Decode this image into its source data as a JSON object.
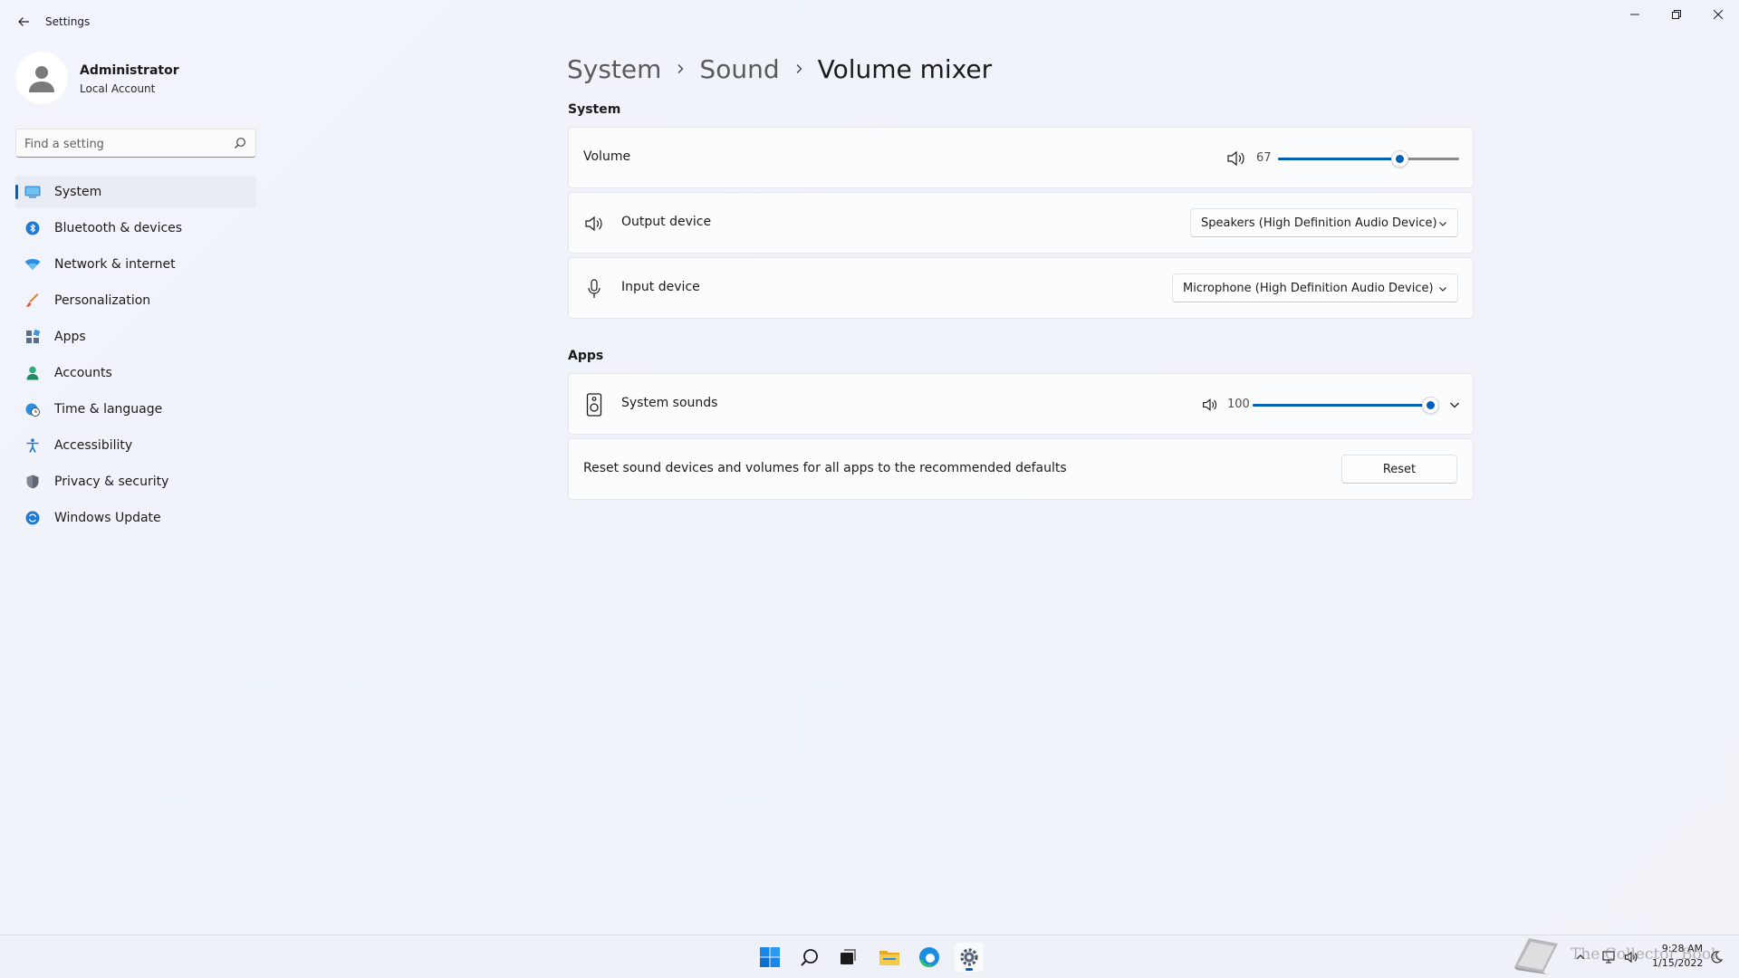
{
  "window": {
    "title": "Settings",
    "controls": [
      "minimize-icon",
      "restore-icon",
      "close-icon"
    ]
  },
  "profile": {
    "name": "Administrator",
    "account_type": "Local Account"
  },
  "search": {
    "placeholder": "Find a setting"
  },
  "sidebar": {
    "items": [
      {
        "label": "System",
        "icon": "system-icon",
        "active": true
      },
      {
        "label": "Bluetooth & devices",
        "icon": "bluetooth-icon"
      },
      {
        "label": "Network & internet",
        "icon": "wifi-icon"
      },
      {
        "label": "Personalization",
        "icon": "brush-icon"
      },
      {
        "label": "Apps",
        "icon": "apps-icon"
      },
      {
        "label": "Accounts",
        "icon": "person-icon"
      },
      {
        "label": "Time & language",
        "icon": "globe-clock-icon"
      },
      {
        "label": "Accessibility",
        "icon": "accessibility-icon"
      },
      {
        "label": "Privacy & security",
        "icon": "shield-icon"
      },
      {
        "label": "Windows Update",
        "icon": "update-icon"
      }
    ]
  },
  "breadcrumb": [
    "System",
    "Sound",
    "Volume mixer"
  ],
  "system_section": {
    "heading": "System",
    "volume": {
      "label": "Volume",
      "value": 67,
      "icon": "speaker-icon"
    },
    "output": {
      "label": "Output device",
      "value": "Speakers (High Definition Audio Device)",
      "icon": "speaker-icon"
    },
    "input": {
      "label": "Input device",
      "value": "Microphone (High Definition Audio Device)",
      "icon": "microphone-icon"
    }
  },
  "apps_section": {
    "heading": "Apps",
    "system_sounds": {
      "label": "System sounds",
      "value": 100,
      "icon": "device-speaker-icon"
    },
    "reset": {
      "text": "Reset sound devices and volumes for all apps to the recommended defaults",
      "button": "Reset"
    }
  },
  "taskbar": {
    "apps": [
      "start-icon",
      "search-icon",
      "task-view-icon",
      "file-explorer-icon",
      "edge-icon",
      "settings-icon"
    ],
    "tray": [
      "chevron-up-icon",
      "network-icon",
      "volume-icon"
    ],
    "time": "9:28 AM",
    "date": "1/15/2022",
    "watermark": "The Collector Book"
  },
  "colors": {
    "accent": "#005fb8",
    "background": "#f1f4fa",
    "card": "#fbfcfe"
  }
}
